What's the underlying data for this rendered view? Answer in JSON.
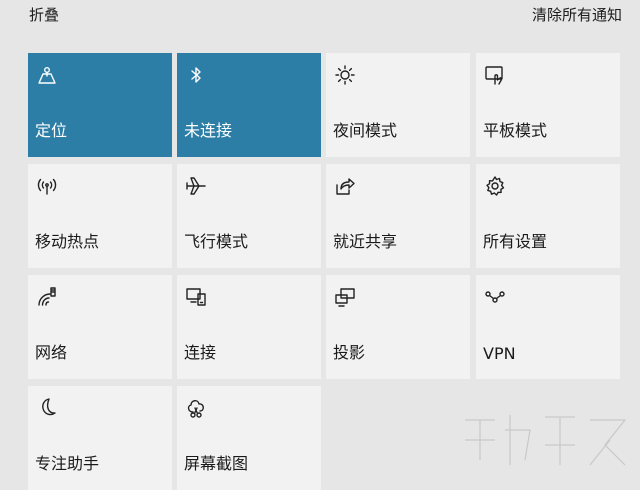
{
  "header": {
    "collapse_label": "折叠",
    "clear_label": "清除所有通知"
  },
  "tiles": [
    {
      "label": "定位",
      "icon": "location-icon",
      "active": true
    },
    {
      "label": "未连接",
      "icon": "bluetooth-icon",
      "active": true
    },
    {
      "label": "夜间模式",
      "icon": "night-mode-icon",
      "active": false
    },
    {
      "label": "平板模式",
      "icon": "tablet-mode-icon",
      "active": false
    },
    {
      "label": "移动热点",
      "icon": "hotspot-icon",
      "active": false
    },
    {
      "label": "飞行模式",
      "icon": "airplane-icon",
      "active": false
    },
    {
      "label": "就近共享",
      "icon": "nearby-share-icon",
      "active": false
    },
    {
      "label": "所有设置",
      "icon": "gear-icon",
      "active": false
    },
    {
      "label": "网络",
      "icon": "network-icon",
      "active": false
    },
    {
      "label": "连接",
      "icon": "connect-icon",
      "active": false
    },
    {
      "label": "投影",
      "icon": "project-icon",
      "active": false
    },
    {
      "label": "VPN",
      "icon": "vpn-icon",
      "active": false
    },
    {
      "label": "专注助手",
      "icon": "focus-assist-icon",
      "active": false
    },
    {
      "label": "屏幕截图",
      "icon": "screen-snip-icon",
      "active": false
    }
  ],
  "colors": {
    "panel_bg": "#e6e6e6",
    "tile_bg": "#f2f2f2",
    "tile_active_bg": "#2c7ea6"
  }
}
